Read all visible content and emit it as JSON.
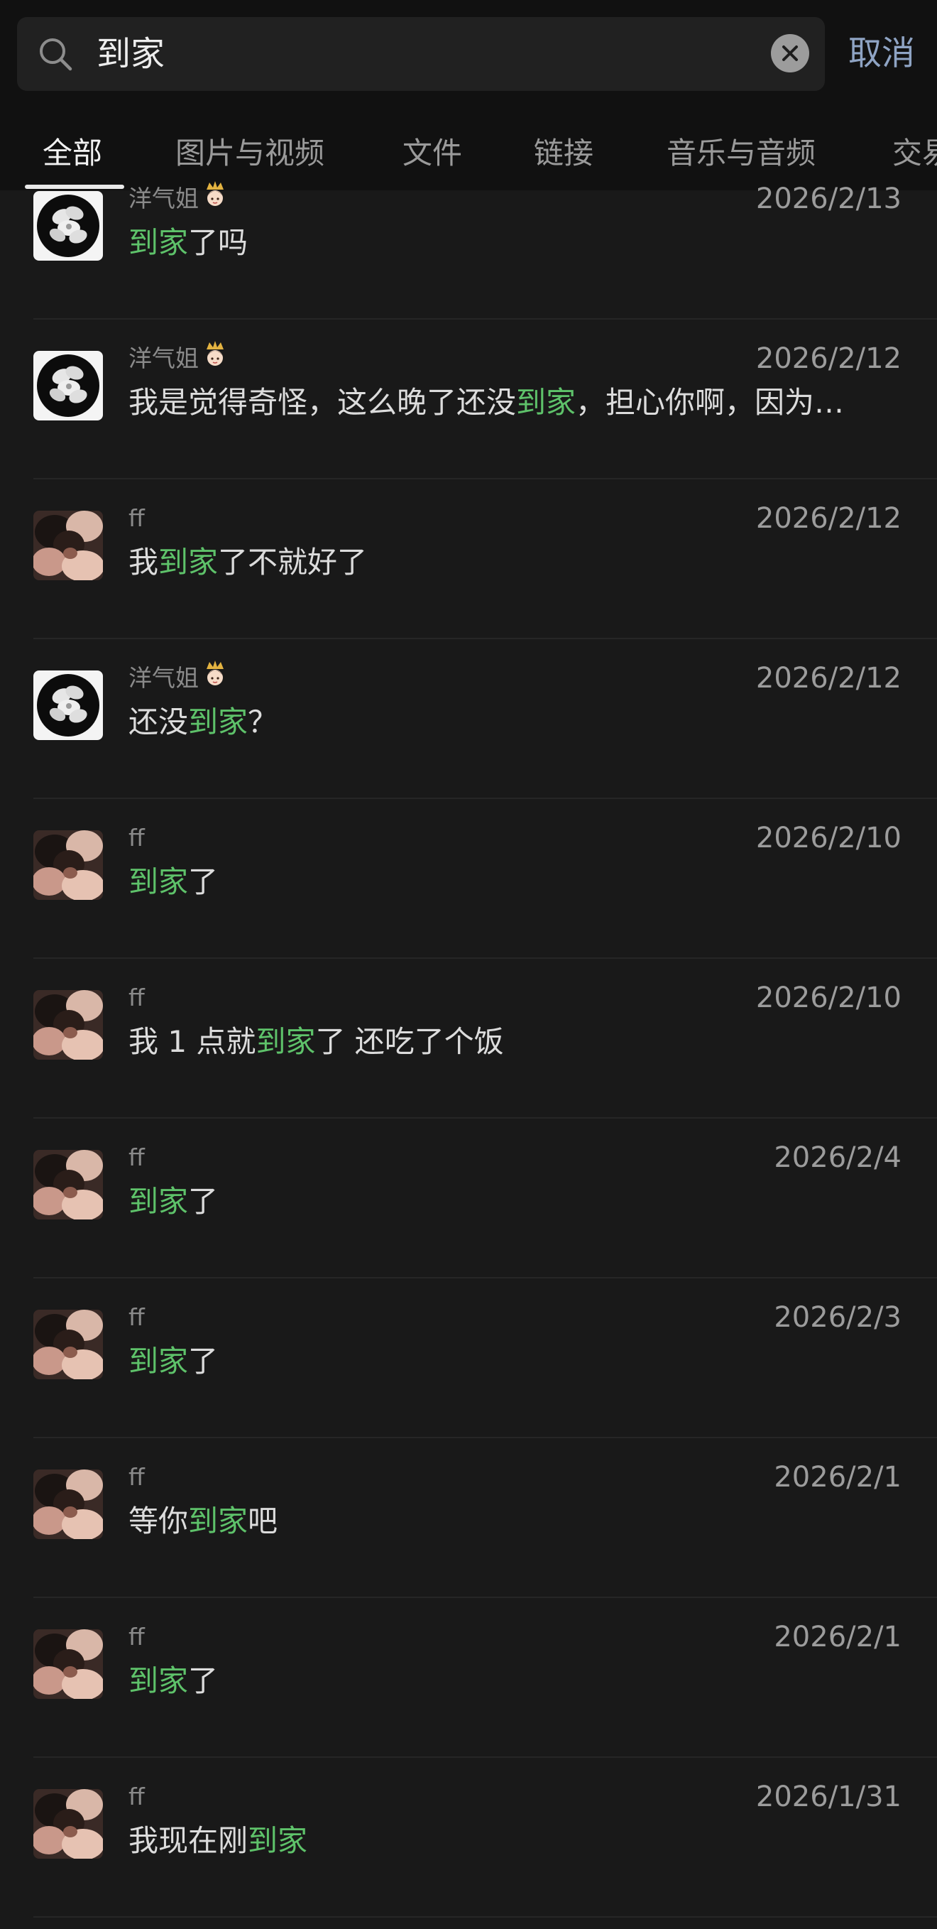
{
  "search": {
    "query": "到家",
    "cancel_label": "取消"
  },
  "tabs": [
    {
      "label": "全部",
      "active": true
    },
    {
      "label": "图片与视频"
    },
    {
      "label": "文件"
    },
    {
      "label": "链接"
    },
    {
      "label": "音乐与音频"
    },
    {
      "label": "交易"
    }
  ],
  "highlight_color": "#5ec26a",
  "results": [
    {
      "sender": "洋气姐",
      "crown": true,
      "avatar": "flower-avatar",
      "date": "2026/2/13",
      "before": "",
      "keyword": "到家",
      "after": "了吗"
    },
    {
      "sender": "洋气姐",
      "crown": true,
      "avatar": "flower-avatar",
      "date": "2026/2/12",
      "before": "我是觉得奇怪，这么晚了还没",
      "keyword": "到家",
      "after": "，担心你啊，因为…"
    },
    {
      "sender": "ff",
      "crown": false,
      "avatar": "photo-avatar",
      "date": "2026/2/12",
      "before": "我",
      "keyword": "到家",
      "after": "了不就好了"
    },
    {
      "sender": "洋气姐",
      "crown": true,
      "avatar": "flower-avatar",
      "date": "2026/2/12",
      "before": "还没",
      "keyword": "到家",
      "after": "？"
    },
    {
      "sender": "ff",
      "crown": false,
      "avatar": "photo-avatar",
      "date": "2026/2/10",
      "before": "",
      "keyword": "到家",
      "after": "了"
    },
    {
      "sender": "ff",
      "crown": false,
      "avatar": "photo-avatar",
      "date": "2026/2/10",
      "before": "我 1 点就",
      "keyword": "到家",
      "after": "了 还吃了个饭"
    },
    {
      "sender": "ff",
      "crown": false,
      "avatar": "photo-avatar",
      "date": "2026/2/4",
      "before": "",
      "keyword": "到家",
      "after": "了"
    },
    {
      "sender": "ff",
      "crown": false,
      "avatar": "photo-avatar",
      "date": "2026/2/3",
      "before": "",
      "keyword": "到家",
      "after": "了"
    },
    {
      "sender": "ff",
      "crown": false,
      "avatar": "photo-avatar",
      "date": "2026/2/1",
      "before": "等你",
      "keyword": "到家",
      "after": "吧"
    },
    {
      "sender": "ff",
      "crown": false,
      "avatar": "photo-avatar",
      "date": "2026/2/1",
      "before": "",
      "keyword": "到家",
      "after": "了"
    },
    {
      "sender": "ff",
      "crown": false,
      "avatar": "photo-avatar",
      "date": "2026/1/31",
      "before": "我现在刚",
      "keyword": "到家",
      "after": ""
    }
  ]
}
